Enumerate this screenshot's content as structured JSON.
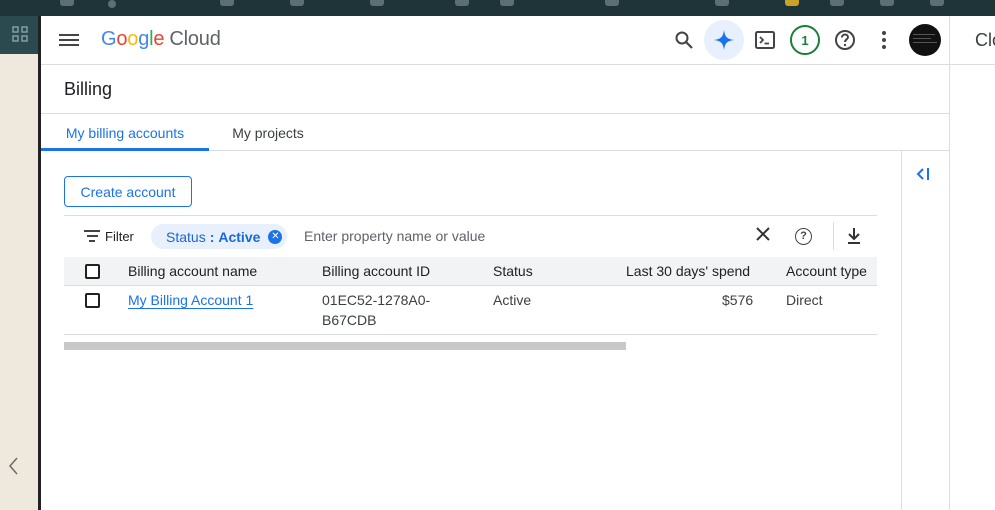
{
  "header": {
    "logo": {
      "g1": "G",
      "g2": "o",
      "g3": "o",
      "g4": "g",
      "g5": "l",
      "g6": "e",
      "cloud": "Cloud"
    },
    "icons": [
      "menu-icon",
      "search-icon",
      "gemini-icon",
      "terminal-icon",
      "help-icon",
      "more-vert-icon"
    ],
    "notification_count": "1"
  },
  "page": {
    "title": "Billing"
  },
  "tabs": [
    {
      "label": "My billing accounts",
      "active": true
    },
    {
      "label": "My projects",
      "active": false
    }
  ],
  "actions": {
    "create_label": "Create account"
  },
  "filter": {
    "label": "Filter",
    "chip_key": "Status",
    "chip_sep": ":",
    "chip_value": "Active",
    "placeholder": "Enter property name or value"
  },
  "table": {
    "headers": [
      "Billing account name",
      "Billing account ID",
      "Status",
      "Last 30 days' spend",
      "Account type"
    ],
    "rows": [
      {
        "name": "My Billing Account 1",
        "id_line1": "01EC52-1278A0-",
        "id_line2": "B67CDB",
        "status": "Active",
        "spend": "$576",
        "type": "Direct"
      }
    ]
  },
  "right_strip": {
    "cut_text": "Clo"
  },
  "colors": {
    "accent": "#1a73e8",
    "badge": "#188038",
    "chip_bg": "#e8f0fe"
  }
}
